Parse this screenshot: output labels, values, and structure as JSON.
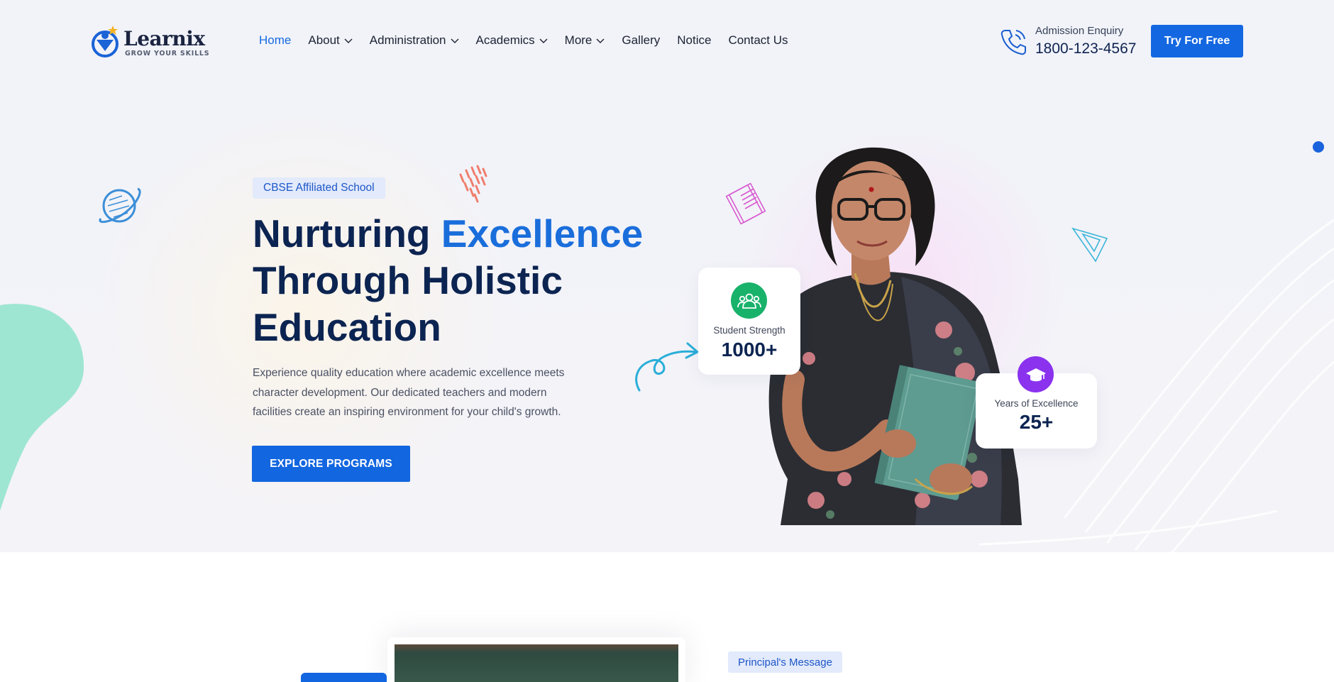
{
  "brand": {
    "name": "Learnix",
    "tagline": "GROW YOUR SKILLS"
  },
  "nav": {
    "items": [
      {
        "label": "Home",
        "active": true,
        "dropdown": false
      },
      {
        "label": "About",
        "active": false,
        "dropdown": true
      },
      {
        "label": "Administration",
        "active": false,
        "dropdown": true
      },
      {
        "label": "Academics",
        "active": false,
        "dropdown": true
      },
      {
        "label": "More",
        "active": false,
        "dropdown": true
      },
      {
        "label": "Gallery",
        "active": false,
        "dropdown": false
      },
      {
        "label": "Notice",
        "active": false,
        "dropdown": false
      },
      {
        "label": "Contact Us",
        "active": false,
        "dropdown": false
      }
    ]
  },
  "enquiry": {
    "label": "Admission Enquiry",
    "phone": "1800-123-4567",
    "icon": "phone-icon"
  },
  "header": {
    "cta_label": "Try For Free"
  },
  "hero": {
    "badge": "CBSE Affiliated School",
    "title_part1": "Nurturing ",
    "title_accent": "Excellence",
    "title_line2": "Through Holistic",
    "title_line3": "Education",
    "description": "Experience quality education where academic excellence meets character development. Our dedicated teachers and modern facilities create an inspiring environment for your child's growth.",
    "cta_label": "EXPLORE PROGRAMS"
  },
  "stats": [
    {
      "label": "Student Strength",
      "value": "1000+",
      "icon": "users-icon",
      "color": "#19b26b"
    },
    {
      "label": "Years of Excellence",
      "value": "25+",
      "icon": "graduation-cap-icon",
      "color": "#8a32ee"
    }
  ],
  "principal": {
    "badge": "Principal's Message"
  },
  "colors": {
    "primary": "#1367e0",
    "heading": "#0c2451",
    "accent_text": "#1a6edb"
  }
}
